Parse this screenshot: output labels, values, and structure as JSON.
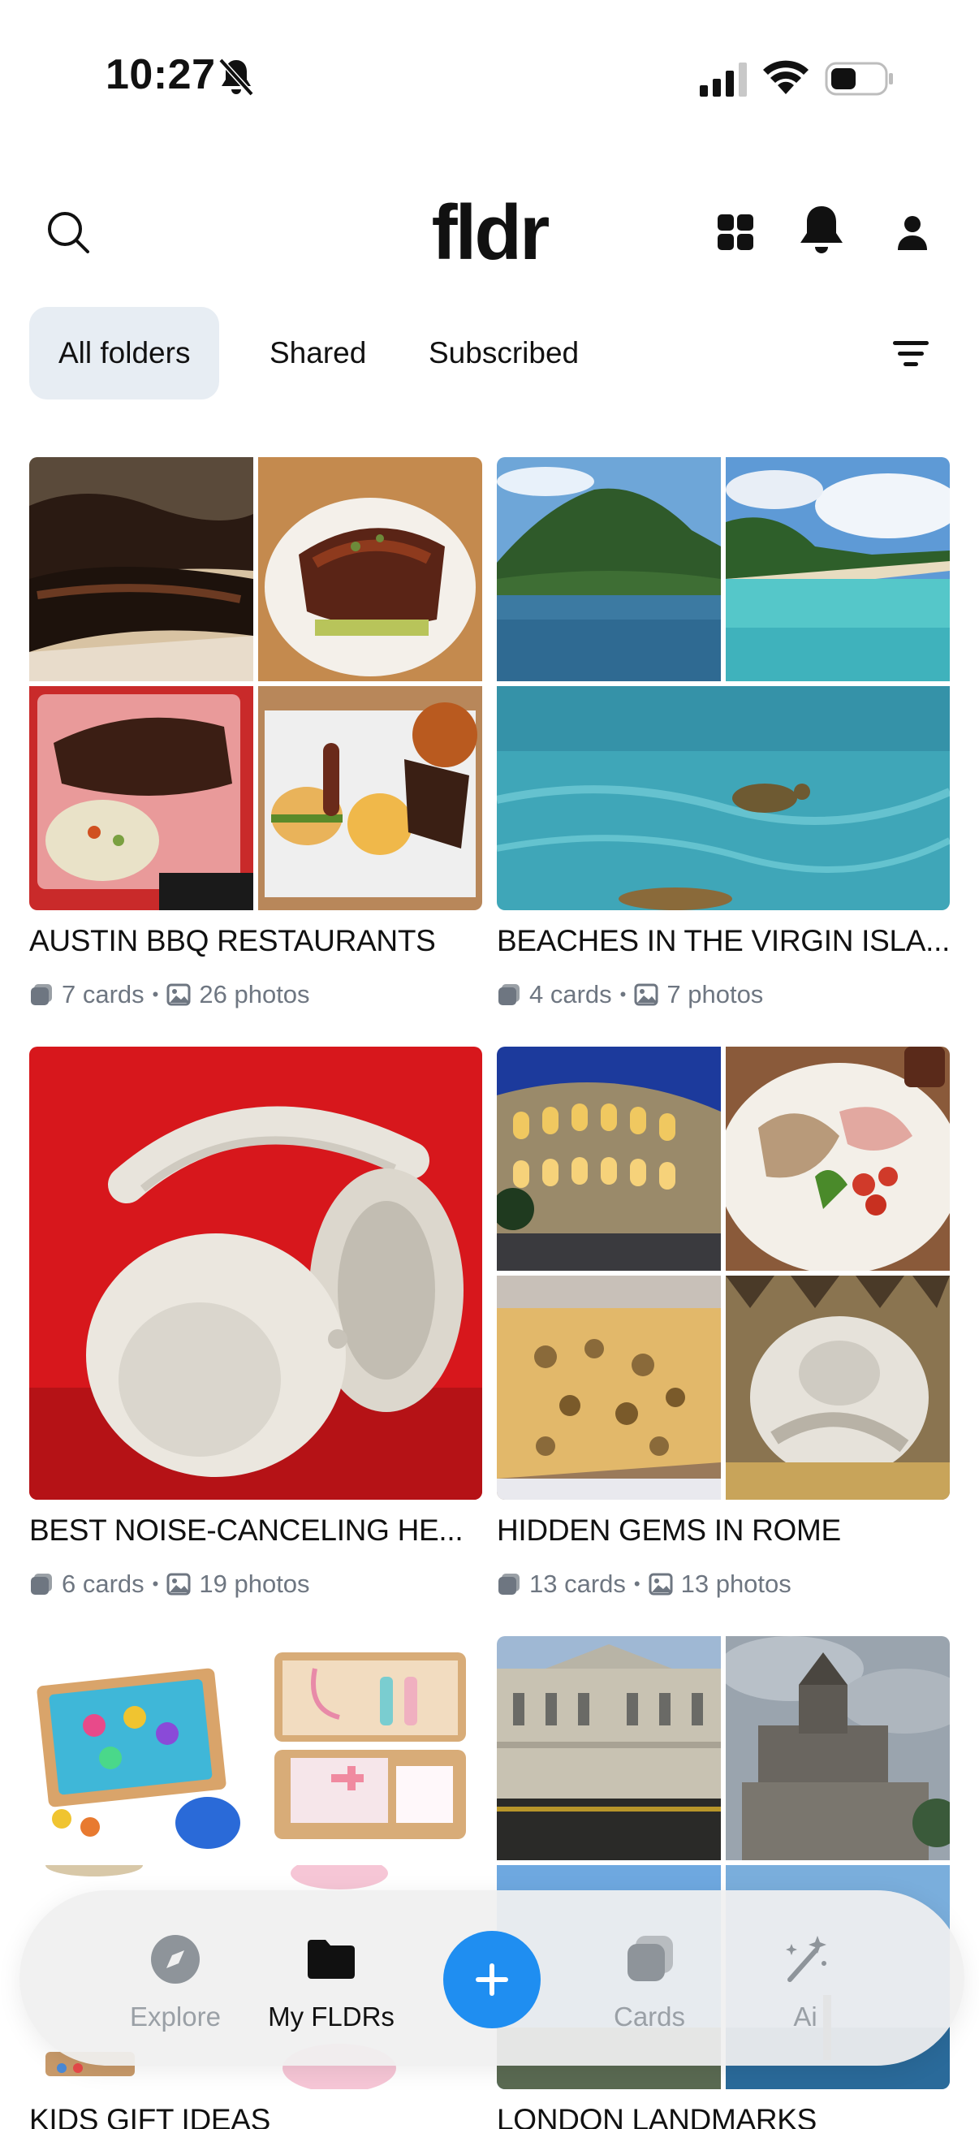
{
  "status_bar": {
    "time": "10:27",
    "icons": [
      "bell-off-icon",
      "signal-icon",
      "wifi-icon",
      "battery-icon"
    ]
  },
  "header": {
    "brand": "fldr",
    "icons": [
      "search-icon",
      "grid-icon",
      "bell-icon",
      "profile-icon"
    ]
  },
  "tabs": [
    {
      "label": "All folders",
      "active": true
    },
    {
      "label": "Shared",
      "active": false
    },
    {
      "label": "Subscribed",
      "active": false
    }
  ],
  "folders": [
    {
      "title": "AUSTIN BBQ RESTAURANTS",
      "cards": "7 cards",
      "photos": "26 photos"
    },
    {
      "title": "BEACHES IN THE VIRGIN ISLA...",
      "cards": "4 cards",
      "photos": "7 photos"
    },
    {
      "title": "BEST NOISE-CANCELING HE...",
      "cards": "6 cards",
      "photos": "19 photos"
    },
    {
      "title": "HIDDEN GEMS IN ROME",
      "cards": "13 cards",
      "photos": "13 photos"
    },
    {
      "title": "KIDS GIFT IDEAS",
      "cards": "",
      "photos": ""
    },
    {
      "title": "LONDON LANDMARKS",
      "cards": "",
      "photos": ""
    }
  ],
  "separator": "•",
  "bottom_nav": {
    "items": [
      {
        "label": "Explore",
        "icon": "compass-icon",
        "active": false
      },
      {
        "label": "My FLDRs",
        "icon": "folder-icon",
        "active": true
      },
      {
        "label": "Cards",
        "icon": "cards-icon",
        "active": false
      },
      {
        "label": "Ai",
        "icon": "magic-wand-icon",
        "active": false
      }
    ],
    "fab_icon": "plus-icon"
  },
  "colors": {
    "accent": "#1f8ef1",
    "tab_active_bg": "#e7edf3",
    "meta_text": "#6e7681",
    "nav_inactive": "#9aa0a6"
  }
}
